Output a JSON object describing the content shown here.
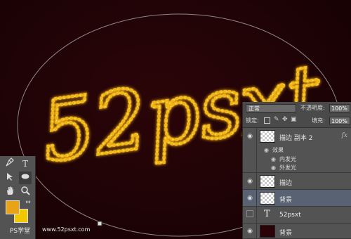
{
  "canvas": {
    "artwork_text": "52psxt",
    "sparkle_color": "#f2b516",
    "background_color": "#1f0306"
  },
  "layers_panel": {
    "blend_mode": "正常",
    "opacity_label": "不透明度:",
    "opacity_value": "100%",
    "lock_label": "锁定:",
    "fill_label": "填充:",
    "fill_value": "100%",
    "layers": [
      {
        "name": "描边 副本 2",
        "fx": "fx",
        "effects_label": "效果",
        "effects": [
          "内发光",
          "外发光"
        ]
      },
      {
        "name": "描边"
      },
      {
        "name": "背景",
        "selected": true
      },
      {
        "name": "52psxt",
        "type": "text",
        "type_icon": "T"
      },
      {
        "name": "背景"
      }
    ]
  },
  "tools_panel": {
    "icons": [
      "pen-icon",
      "type-icon",
      "path-select-icon",
      "ellipse-icon",
      "hand-icon",
      "zoom-icon"
    ],
    "type_glyph": "T",
    "foreground_color": "#e8a317",
    "background_color": "#f0c800"
  },
  "watermark": {
    "left": "PS学堂",
    "right": "www.52psxt.com"
  }
}
